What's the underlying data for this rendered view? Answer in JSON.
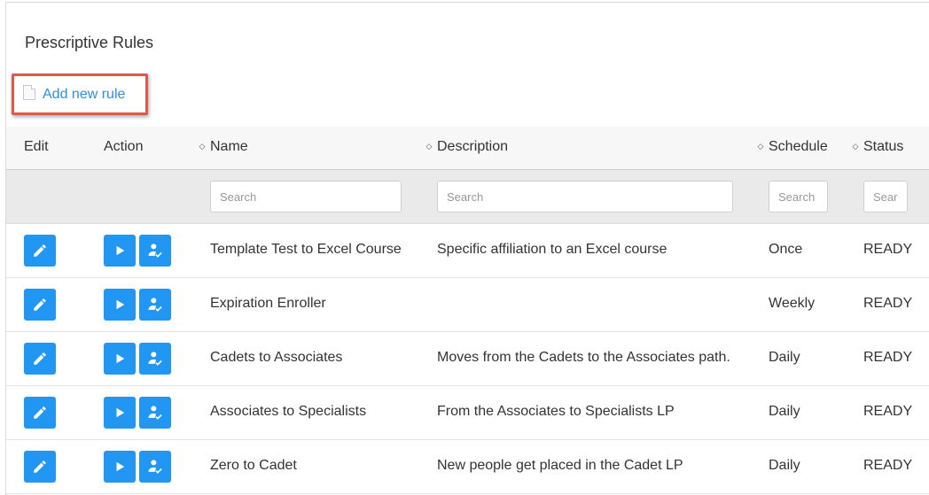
{
  "page": {
    "title": "Prescriptive Rules"
  },
  "toolbar": {
    "add_rule_label": "Add new rule",
    "add_rule_icon": "document-icon"
  },
  "columns": {
    "edit": "Edit",
    "action": "Action",
    "name": "Name",
    "description": "Description",
    "schedule": "Schedule",
    "status": "Status"
  },
  "filters": {
    "name_placeholder": "Search",
    "description_placeholder": "Search",
    "schedule_placeholder": "Search",
    "status_placeholder": "Search"
  },
  "rows": [
    {
      "name": "Template Test to Excel Course",
      "description": "Specific affiliation to an Excel course",
      "schedule": "Once",
      "status": "READY"
    },
    {
      "name": "Expiration Enroller",
      "description": "",
      "schedule": "Weekly",
      "status": "READY"
    },
    {
      "name": "Cadets to Associates",
      "description": "Moves from the Cadets to the Associates path.",
      "schedule": "Daily",
      "status": "READY"
    },
    {
      "name": "Associates to Specialists",
      "description": "From the Associates to Specialists LP",
      "schedule": "Daily",
      "status": "READY"
    },
    {
      "name": "Zero to Cadet",
      "description": "New people get placed in the Cadet LP",
      "schedule": "Daily",
      "status": "READY"
    }
  ],
  "colors": {
    "accent": "#2196f3",
    "link": "#2f8fd8",
    "highlight_border": "#e0584a"
  }
}
